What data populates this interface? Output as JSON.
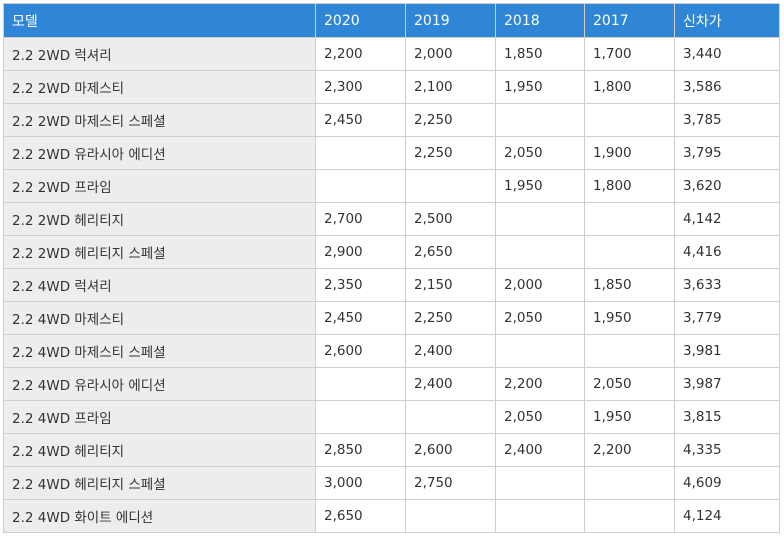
{
  "header": {
    "columns": [
      "모델",
      "2020",
      "2019",
      "2018",
      "2017",
      "신차가"
    ]
  },
  "rows": [
    {
      "model": "2.2 2WD 럭셔리",
      "y2020": "2,200",
      "y2019": "2,000",
      "y2018": "1,850",
      "y2017": "1,700",
      "new_price": "3,440"
    },
    {
      "model": "2.2 2WD 마제스티",
      "y2020": "2,300",
      "y2019": "2,100",
      "y2018": "1,950",
      "y2017": "1,800",
      "new_price": "3,586"
    },
    {
      "model": "2.2 2WD 마제스티 스페셜",
      "y2020": "2,450",
      "y2019": "2,250",
      "y2018": "",
      "y2017": "",
      "new_price": "3,785"
    },
    {
      "model": "2.2 2WD 유라시아 에디션",
      "y2020": "",
      "y2019": "2,250",
      "y2018": "2,050",
      "y2017": "1,900",
      "new_price": "3,795"
    },
    {
      "model": "2.2 2WD 프라임",
      "y2020": "",
      "y2019": "",
      "y2018": "1,950",
      "y2017": "1,800",
      "new_price": "3,620"
    },
    {
      "model": "2.2 2WD 헤리티지",
      "y2020": "2,700",
      "y2019": "2,500",
      "y2018": "",
      "y2017": "",
      "new_price": "4,142"
    },
    {
      "model": "2.2 2WD 헤리티지 스페셜",
      "y2020": "2,900",
      "y2019": "2,650",
      "y2018": "",
      "y2017": "",
      "new_price": "4,416"
    },
    {
      "model": "2.2 4WD 럭셔리",
      "y2020": "2,350",
      "y2019": "2,150",
      "y2018": "2,000",
      "y2017": "1,850",
      "new_price": "3,633"
    },
    {
      "model": "2.2 4WD 마제스티",
      "y2020": "2,450",
      "y2019": "2,250",
      "y2018": "2,050",
      "y2017": "1,950",
      "new_price": "3,779"
    },
    {
      "model": "2.2 4WD 마제스티 스페셜",
      "y2020": "2,600",
      "y2019": "2,400",
      "y2018": "",
      "y2017": "",
      "new_price": "3,981"
    },
    {
      "model": "2.2 4WD 유라시아 에디션",
      "y2020": "",
      "y2019": "2,400",
      "y2018": "2,200",
      "y2017": "2,050",
      "new_price": "3,987"
    },
    {
      "model": "2.2 4WD 프라임",
      "y2020": "",
      "y2019": "",
      "y2018": "2,050",
      "y2017": "1,950",
      "new_price": "3,815"
    },
    {
      "model": "2.2 4WD 헤리티지",
      "y2020": "2,850",
      "y2019": "2,600",
      "y2018": "2,400",
      "y2017": "2,200",
      "new_price": "4,335"
    },
    {
      "model": "2.2 4WD 헤리티지 스페셜",
      "y2020": "3,000",
      "y2019": "2,750",
      "y2018": "",
      "y2017": "",
      "new_price": "4,609"
    },
    {
      "model": "2.2 4WD 화이트 에디션",
      "y2020": "2,650",
      "y2019": "",
      "y2018": "",
      "y2017": "",
      "new_price": "4,124"
    }
  ],
  "colors": {
    "header_bg": "#2f86d6",
    "header_text": "#ffffff",
    "model_cell_bg": "#ededed",
    "border": "#cfcfcf"
  }
}
